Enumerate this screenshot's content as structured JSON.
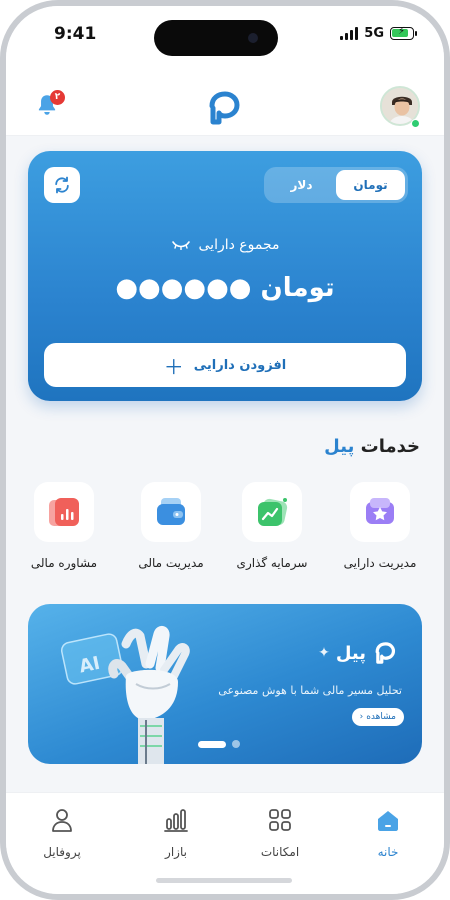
{
  "status_bar": {
    "time": "9:41",
    "network": "5G",
    "battery_level": 0.85
  },
  "header": {
    "notification_count": "۲"
  },
  "balance_card": {
    "currency_options": [
      "دلار",
      "تومان"
    ],
    "selected_currency": "تومان",
    "total_label": "مجموع دارایی",
    "masked_amount": "●●●●●●",
    "amount_unit": "تومان",
    "add_asset_label": "افزودن دارایی"
  },
  "services": {
    "title_prefix": "خدمات",
    "title_brand": "پیل",
    "items": [
      {
        "label": "مدیریت دارایی",
        "icon": "wallet-star-icon",
        "color": "#8b6cf0"
      },
      {
        "label": "سرمایه گذاری",
        "icon": "investment-chart-icon",
        "color": "#3cc36b"
      },
      {
        "label": "مدیریت مالی",
        "icon": "wallet-icon",
        "color": "#3b8fe0"
      },
      {
        "label": "مشاوره مالی",
        "icon": "report-chart-icon",
        "color": "#f0605a"
      }
    ]
  },
  "banner": {
    "brand_name": "پیل",
    "subtitle": "تحلیل مسیر مالی شما با هوش مصنوعی",
    "view_label": "مشاهده",
    "ai_label": "AI",
    "slide_count": 2,
    "active_slide": 1
  },
  "bottom_nav": [
    {
      "label": "خانه",
      "icon": "home-icon",
      "active": true
    },
    {
      "label": "امکانات",
      "icon": "grid-icon",
      "active": false
    },
    {
      "label": "بازار",
      "icon": "market-chart-icon",
      "active": false
    },
    {
      "label": "پروفایل",
      "icon": "profile-icon",
      "active": false
    }
  ],
  "colors": {
    "brand": "#2b83cf",
    "notification": "#e53935",
    "online": "#2ecc71"
  }
}
